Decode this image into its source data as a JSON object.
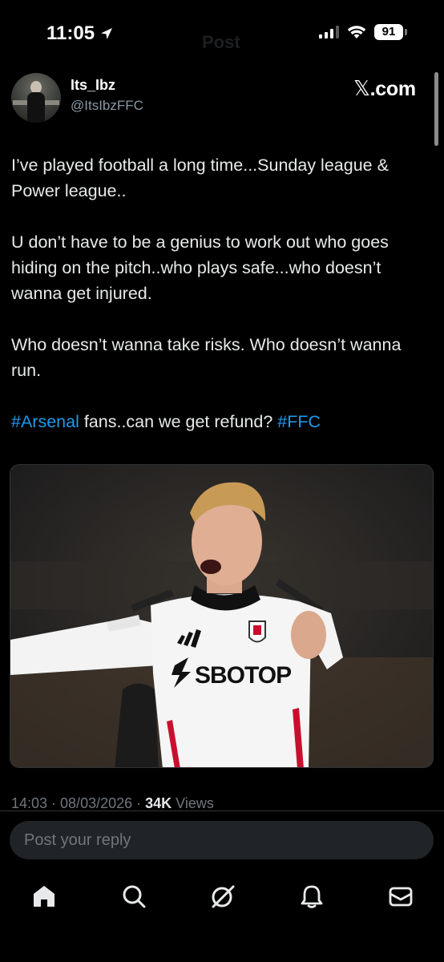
{
  "status_bar": {
    "time": "11:05",
    "battery": "91",
    "ghost_title": "Post"
  },
  "author": {
    "display_name": "Its_Ibz",
    "handle": "@ItsIbzFFC"
  },
  "brand": {
    "text": ".com",
    "x_glyph": "𝕏"
  },
  "tweet": {
    "paragraph_1": "I’ve played football a long time...Sunday league & Power league..",
    "paragraph_2": "U don’t have to be a genius to work out who goes hiding on the pitch..who plays safe...who doesn’t wanna get injured.",
    "paragraph_3": "Who doesn’t wanna take risks. Who doesn’t wanna run.",
    "paragraph_4": {
      "hashtag_1": "#Arsenal",
      "middle": " fans..can we get refund? ",
      "hashtag_2": "#FFC"
    }
  },
  "media": {
    "shirt_sponsor": "SBOTOP"
  },
  "meta": {
    "timestamp": "14:03 · 08/03/2026 · ",
    "views_count": "34K",
    "views_label": " Views"
  },
  "reply": {
    "placeholder": "Post your reply"
  },
  "nav": {
    "items": [
      "home-icon",
      "search-icon",
      "grok-icon",
      "notifications-icon",
      "messages-icon"
    ]
  },
  "colors": {
    "accent": "#1d9bf0",
    "background": "#000000",
    "muted": "#71767b"
  }
}
